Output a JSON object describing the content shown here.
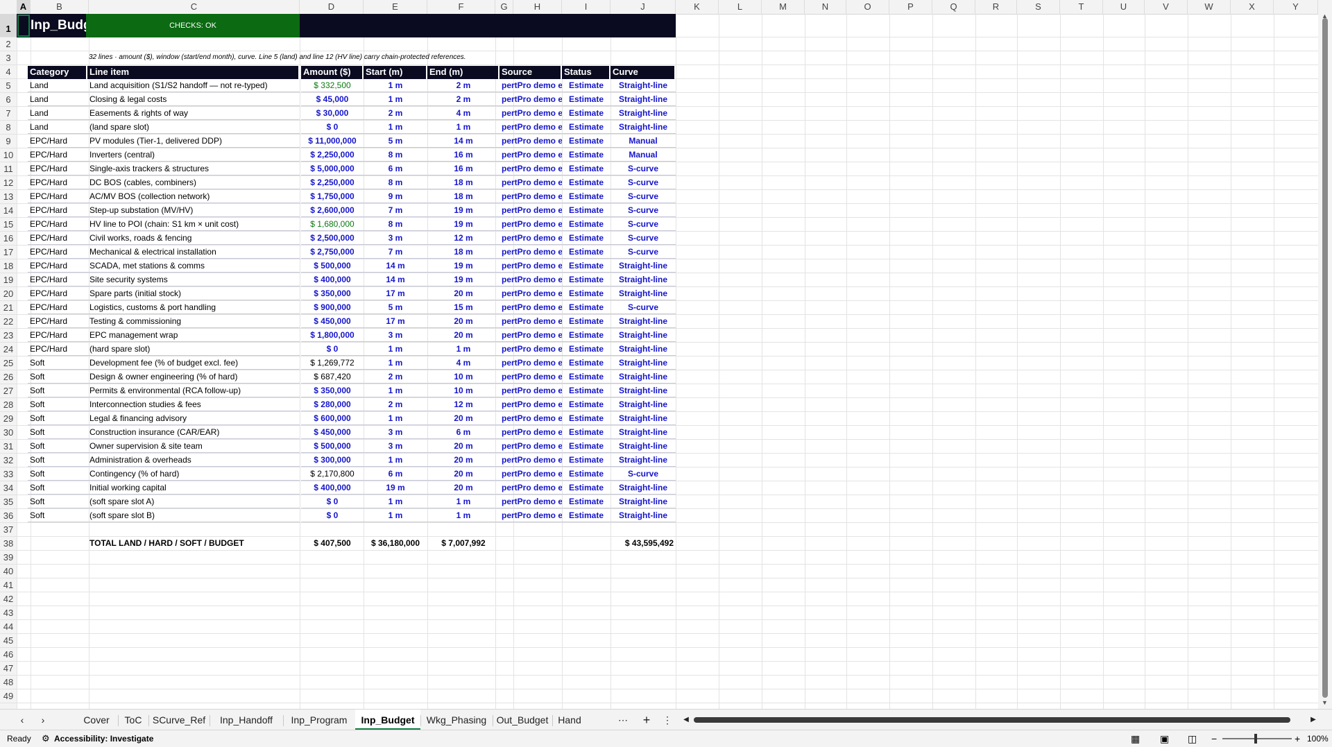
{
  "sheet": {
    "title": "Inp_Budget",
    "checks": "CHECKS: OK",
    "note": "32 lines · amount ($), window (start/end month), curve. Line 5 (land) and line 12 (HV line) carry chain-protected references.",
    "selected_cell": "A1"
  },
  "columns": [
    "A",
    "B",
    "C",
    "D",
    "E",
    "F",
    "G",
    "H",
    "I",
    "J",
    "K",
    "L",
    "M",
    "N",
    "O",
    "P",
    "Q",
    "R",
    "S",
    "T",
    "U",
    "V",
    "W",
    "X",
    "Y"
  ],
  "headers": {
    "category": "Category",
    "line_item": "Line item",
    "amount": "Amount ($)",
    "start": "Start (m)",
    "end": "End (m)",
    "source": "Source",
    "status": "Status",
    "curve": "Curve"
  },
  "rows": [
    {
      "cat": "Land",
      "item": "Land acquisition (S1/S2 handoff — not re-typed)",
      "amt": "$ 332,500",
      "amt_style": "green",
      "start": "1 m",
      "end": "2 m",
      "src": "pertPro demo es",
      "status": "Estimate",
      "curve": "Straight-line"
    },
    {
      "cat": "Land",
      "item": "Closing & legal costs",
      "amt": "$ 45,000",
      "amt_style": "blue",
      "start": "1 m",
      "end": "2 m",
      "src": "pertPro demo es",
      "status": "Estimate",
      "curve": "Straight-line"
    },
    {
      "cat": "Land",
      "item": "Easements & rights of way",
      "amt": "$ 30,000",
      "amt_style": "blue",
      "start": "2 m",
      "end": "4 m",
      "src": "pertPro demo es",
      "status": "Estimate",
      "curve": "Straight-line"
    },
    {
      "cat": "Land",
      "item": "(land spare slot)",
      "amt": "$ 0",
      "amt_style": "blue",
      "start": "1 m",
      "end": "1 m",
      "src": "pertPro demo es",
      "status": "Estimate",
      "curve": "Straight-line"
    },
    {
      "cat": "EPC/Hard",
      "item": "PV modules (Tier-1, delivered DDP)",
      "amt": "$ 11,000,000",
      "amt_style": "blue",
      "start": "5 m",
      "end": "14 m",
      "src": "pertPro demo es",
      "status": "Estimate",
      "curve": "Manual"
    },
    {
      "cat": "EPC/Hard",
      "item": "Inverters (central)",
      "amt": "$ 2,250,000",
      "amt_style": "blue",
      "start": "8 m",
      "end": "16 m",
      "src": "pertPro demo es",
      "status": "Estimate",
      "curve": "Manual"
    },
    {
      "cat": "EPC/Hard",
      "item": "Single-axis trackers & structures",
      "amt": "$ 5,000,000",
      "amt_style": "blue",
      "start": "6 m",
      "end": "16 m",
      "src": "pertPro demo es",
      "status": "Estimate",
      "curve": "S-curve"
    },
    {
      "cat": "EPC/Hard",
      "item": "DC BOS (cables, combiners)",
      "amt": "$ 2,250,000",
      "amt_style": "blue",
      "start": "8 m",
      "end": "18 m",
      "src": "pertPro demo es",
      "status": "Estimate",
      "curve": "S-curve"
    },
    {
      "cat": "EPC/Hard",
      "item": "AC/MV BOS (collection network)",
      "amt": "$ 1,750,000",
      "amt_style": "blue",
      "start": "9 m",
      "end": "18 m",
      "src": "pertPro demo es",
      "status": "Estimate",
      "curve": "S-curve"
    },
    {
      "cat": "EPC/Hard",
      "item": "Step-up substation (MV/HV)",
      "amt": "$ 2,600,000",
      "amt_style": "blue",
      "start": "7 m",
      "end": "19 m",
      "src": "pertPro demo es",
      "status": "Estimate",
      "curve": "S-curve"
    },
    {
      "cat": "EPC/Hard",
      "item": "HV line to POI (chain: S1 km × unit cost)",
      "amt": "$ 1,680,000",
      "amt_style": "green",
      "start": "8 m",
      "end": "19 m",
      "src": "pertPro demo es",
      "status": "Estimate",
      "curve": "S-curve"
    },
    {
      "cat": "EPC/Hard",
      "item": "Civil works, roads & fencing",
      "amt": "$ 2,500,000",
      "amt_style": "blue",
      "start": "3 m",
      "end": "12 m",
      "src": "pertPro demo es",
      "status": "Estimate",
      "curve": "S-curve"
    },
    {
      "cat": "EPC/Hard",
      "item": "Mechanical & electrical installation",
      "amt": "$ 2,750,000",
      "amt_style": "blue",
      "start": "7 m",
      "end": "18 m",
      "src": "pertPro demo es",
      "status": "Estimate",
      "curve": "S-curve"
    },
    {
      "cat": "EPC/Hard",
      "item": "SCADA, met stations & comms",
      "amt": "$ 500,000",
      "amt_style": "blue",
      "start": "14 m",
      "end": "19 m",
      "src": "pertPro demo es",
      "status": "Estimate",
      "curve": "Straight-line"
    },
    {
      "cat": "EPC/Hard",
      "item": "Site security systems",
      "amt": "$ 400,000",
      "amt_style": "blue",
      "start": "14 m",
      "end": "19 m",
      "src": "pertPro demo es",
      "status": "Estimate",
      "curve": "Straight-line"
    },
    {
      "cat": "EPC/Hard",
      "item": "Spare parts (initial stock)",
      "amt": "$ 350,000",
      "amt_style": "blue",
      "start": "17 m",
      "end": "20 m",
      "src": "pertPro demo es",
      "status": "Estimate",
      "curve": "Straight-line"
    },
    {
      "cat": "EPC/Hard",
      "item": "Logistics, customs & port handling",
      "amt": "$ 900,000",
      "amt_style": "blue",
      "start": "5 m",
      "end": "15 m",
      "src": "pertPro demo es",
      "status": "Estimate",
      "curve": "S-curve"
    },
    {
      "cat": "EPC/Hard",
      "item": "Testing & commissioning",
      "amt": "$ 450,000",
      "amt_style": "blue",
      "start": "17 m",
      "end": "20 m",
      "src": "pertPro demo es",
      "status": "Estimate",
      "curve": "Straight-line"
    },
    {
      "cat": "EPC/Hard",
      "item": "EPC management wrap",
      "amt": "$ 1,800,000",
      "amt_style": "blue",
      "start": "3 m",
      "end": "20 m",
      "src": "pertPro demo es",
      "status": "Estimate",
      "curve": "Straight-line"
    },
    {
      "cat": "EPC/Hard",
      "item": "(hard spare slot)",
      "amt": "$ 0",
      "amt_style": "blue",
      "start": "1 m",
      "end": "1 m",
      "src": "pertPro demo es",
      "status": "Estimate",
      "curve": "Straight-line"
    },
    {
      "cat": "Soft",
      "item": "Development fee (% of budget excl. fee)",
      "amt": "$ 1,269,772",
      "amt_style": "black",
      "start": "1 m",
      "end": "4 m",
      "src": "pertPro demo es",
      "status": "Estimate",
      "curve": "Straight-line"
    },
    {
      "cat": "Soft",
      "item": "Design & owner engineering (% of hard)",
      "amt": "$ 687,420",
      "amt_style": "black",
      "start": "2 m",
      "end": "10 m",
      "src": "pertPro demo es",
      "status": "Estimate",
      "curve": "Straight-line"
    },
    {
      "cat": "Soft",
      "item": "Permits & environmental (RCA follow-up)",
      "amt": "$ 350,000",
      "amt_style": "blue",
      "start": "1 m",
      "end": "10 m",
      "src": "pertPro demo es",
      "status": "Estimate",
      "curve": "Straight-line"
    },
    {
      "cat": "Soft",
      "item": "Interconnection studies & fees",
      "amt": "$ 280,000",
      "amt_style": "blue",
      "start": "2 m",
      "end": "12 m",
      "src": "pertPro demo es",
      "status": "Estimate",
      "curve": "Straight-line"
    },
    {
      "cat": "Soft",
      "item": "Legal & financing advisory",
      "amt": "$ 600,000",
      "amt_style": "blue",
      "start": "1 m",
      "end": "20 m",
      "src": "pertPro demo es",
      "status": "Estimate",
      "curve": "Straight-line"
    },
    {
      "cat": "Soft",
      "item": "Construction insurance (CAR/EAR)",
      "amt": "$ 450,000",
      "amt_style": "blue",
      "start": "3 m",
      "end": "6 m",
      "src": "pertPro demo es",
      "status": "Estimate",
      "curve": "Straight-line"
    },
    {
      "cat": "Soft",
      "item": "Owner supervision & site team",
      "amt": "$ 500,000",
      "amt_style": "blue",
      "start": "3 m",
      "end": "20 m",
      "src": "pertPro demo es",
      "status": "Estimate",
      "curve": "Straight-line"
    },
    {
      "cat": "Soft",
      "item": "Administration & overheads",
      "amt": "$ 300,000",
      "amt_style": "blue",
      "start": "1 m",
      "end": "20 m",
      "src": "pertPro demo es",
      "status": "Estimate",
      "curve": "Straight-line"
    },
    {
      "cat": "Soft",
      "item": "Contingency (% of hard)",
      "amt": "$ 2,170,800",
      "amt_style": "black",
      "start": "6 m",
      "end": "20 m",
      "src": "pertPro demo es",
      "status": "Estimate",
      "curve": "S-curve"
    },
    {
      "cat": "Soft",
      "item": "Initial working capital",
      "amt": "$ 400,000",
      "amt_style": "blue",
      "start": "19 m",
      "end": "20 m",
      "src": "pertPro demo es",
      "status": "Estimate",
      "curve": "Straight-line"
    },
    {
      "cat": "Soft",
      "item": "(soft spare slot A)",
      "amt": "$ 0",
      "amt_style": "blue",
      "start": "1 m",
      "end": "1 m",
      "src": "pertPro demo es",
      "status": "Estimate",
      "curve": "Straight-line"
    },
    {
      "cat": "Soft",
      "item": "(soft spare slot B)",
      "amt": "$ 0",
      "amt_style": "blue",
      "start": "1 m",
      "end": "1 m",
      "src": "pertPro demo es",
      "status": "Estimate",
      "curve": "Straight-line"
    }
  ],
  "totals": {
    "label": "TOTAL LAND / HARD / SOFT / BUDGET",
    "land": "$ 407,500",
    "hard": "$ 36,180,000",
    "soft": "$ 7,007,992",
    "budget": "$ 43,595,492"
  },
  "tabs": [
    "Cover",
    "ToC",
    "SCurve_Ref",
    "Inp_Handoff",
    "Inp_Program",
    "Inp_Budget",
    "Wkg_Phasing",
    "Out_Budget",
    "Hand"
  ],
  "active_tab": "Inp_Budget",
  "status_bar": {
    "ready": "Ready",
    "accessibility": "Accessibility: Investigate",
    "zoom": "100%"
  },
  "colors": {
    "header_bg": "#0a0b20",
    "checks_bg": "#0b6a12",
    "input_blue": "#1515cc",
    "link_green": "#0a7a10",
    "accent": "#107c41"
  }
}
